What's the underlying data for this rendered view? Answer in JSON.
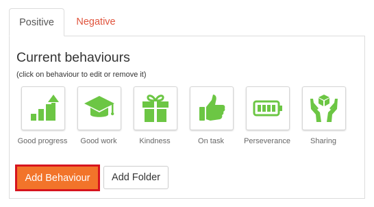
{
  "colors": {
    "icon_green": "#6cc644",
    "accent_orange": "#f2742a",
    "focus_red": "#d6141e",
    "negative_tab_red": "#e0533c"
  },
  "tabs": [
    {
      "label": "Positive",
      "active": true
    },
    {
      "label": "Negative",
      "active": false
    }
  ],
  "panel": {
    "title": "Current behaviours",
    "hint": "(click on behaviour to edit or remove it)"
  },
  "behaviours": [
    {
      "label": "Good progress",
      "icon": "bar-chart-arrow-icon"
    },
    {
      "label": "Good work",
      "icon": "graduation-cap-icon"
    },
    {
      "label": "Kindness",
      "icon": "gift-icon"
    },
    {
      "label": "On task",
      "icon": "thumbs-up-icon"
    },
    {
      "label": "Perseverance",
      "icon": "battery-icon"
    },
    {
      "label": "Sharing",
      "icon": "hands-cube-icon"
    }
  ],
  "buttons": {
    "add_behaviour": "Add Behaviour",
    "add_folder": "Add Folder"
  }
}
